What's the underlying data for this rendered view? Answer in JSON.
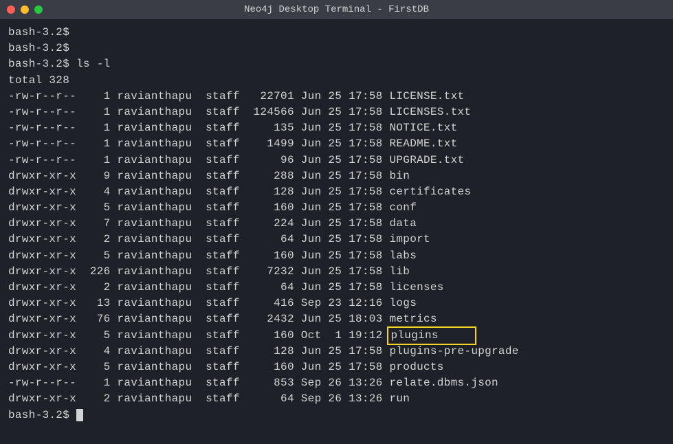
{
  "window": {
    "title": "Neo4j Desktop Terminal - FirstDB"
  },
  "prompt": "bash-3.2$",
  "command": "ls -l",
  "total_line": "total 328",
  "rows": [
    {
      "perm": "-rw-r--r--",
      "links": "1",
      "owner": "ravianthapu",
      "group": "staff",
      "size": "22701",
      "month": "Jun",
      "day": "25",
      "time": "17:58",
      "name": "LICENSE.txt",
      "hl": false
    },
    {
      "perm": "-rw-r--r--",
      "links": "1",
      "owner": "ravianthapu",
      "group": "staff",
      "size": "124566",
      "month": "Jun",
      "day": "25",
      "time": "17:58",
      "name": "LICENSES.txt",
      "hl": false
    },
    {
      "perm": "-rw-r--r--",
      "links": "1",
      "owner": "ravianthapu",
      "group": "staff",
      "size": "135",
      "month": "Jun",
      "day": "25",
      "time": "17:58",
      "name": "NOTICE.txt",
      "hl": false
    },
    {
      "perm": "-rw-r--r--",
      "links": "1",
      "owner": "ravianthapu",
      "group": "staff",
      "size": "1499",
      "month": "Jun",
      "day": "25",
      "time": "17:58",
      "name": "README.txt",
      "hl": false
    },
    {
      "perm": "-rw-r--r--",
      "links": "1",
      "owner": "ravianthapu",
      "group": "staff",
      "size": "96",
      "month": "Jun",
      "day": "25",
      "time": "17:58",
      "name": "UPGRADE.txt",
      "hl": false
    },
    {
      "perm": "drwxr-xr-x",
      "links": "9",
      "owner": "ravianthapu",
      "group": "staff",
      "size": "288",
      "month": "Jun",
      "day": "25",
      "time": "17:58",
      "name": "bin",
      "hl": false
    },
    {
      "perm": "drwxr-xr-x",
      "links": "4",
      "owner": "ravianthapu",
      "group": "staff",
      "size": "128",
      "month": "Jun",
      "day": "25",
      "time": "17:58",
      "name": "certificates",
      "hl": false
    },
    {
      "perm": "drwxr-xr-x",
      "links": "5",
      "owner": "ravianthapu",
      "group": "staff",
      "size": "160",
      "month": "Jun",
      "day": "25",
      "time": "17:58",
      "name": "conf",
      "hl": false
    },
    {
      "perm": "drwxr-xr-x",
      "links": "7",
      "owner": "ravianthapu",
      "group": "staff",
      "size": "224",
      "month": "Jun",
      "day": "25",
      "time": "17:58",
      "name": "data",
      "hl": false
    },
    {
      "perm": "drwxr-xr-x",
      "links": "2",
      "owner": "ravianthapu",
      "group": "staff",
      "size": "64",
      "month": "Jun",
      "day": "25",
      "time": "17:58",
      "name": "import",
      "hl": false
    },
    {
      "perm": "drwxr-xr-x",
      "links": "5",
      "owner": "ravianthapu",
      "group": "staff",
      "size": "160",
      "month": "Jun",
      "day": "25",
      "time": "17:58",
      "name": "labs",
      "hl": false
    },
    {
      "perm": "drwxr-xr-x",
      "links": "226",
      "owner": "ravianthapu",
      "group": "staff",
      "size": "7232",
      "month": "Jun",
      "day": "25",
      "time": "17:58",
      "name": "lib",
      "hl": false
    },
    {
      "perm": "drwxr-xr-x",
      "links": "2",
      "owner": "ravianthapu",
      "group": "staff",
      "size": "64",
      "month": "Jun",
      "day": "25",
      "time": "17:58",
      "name": "licenses",
      "hl": false
    },
    {
      "perm": "drwxr-xr-x",
      "links": "13",
      "owner": "ravianthapu",
      "group": "staff",
      "size": "416",
      "month": "Sep",
      "day": "23",
      "time": "12:16",
      "name": "logs",
      "hl": false
    },
    {
      "perm": "drwxr-xr-x",
      "links": "76",
      "owner": "ravianthapu",
      "group": "staff",
      "size": "2432",
      "month": "Jun",
      "day": "25",
      "time": "18:03",
      "name": "metrics",
      "hl": false
    },
    {
      "perm": "drwxr-xr-x",
      "links": "5",
      "owner": "ravianthapu",
      "group": "staff",
      "size": "160",
      "month": "Oct",
      "day": "1",
      "time": "19:12",
      "name": "plugins",
      "hl": true
    },
    {
      "perm": "drwxr-xr-x",
      "links": "4",
      "owner": "ravianthapu",
      "group": "staff",
      "size": "128",
      "month": "Jun",
      "day": "25",
      "time": "17:58",
      "name": "plugins-pre-upgrade",
      "hl": false
    },
    {
      "perm": "drwxr-xr-x",
      "links": "5",
      "owner": "ravianthapu",
      "group": "staff",
      "size": "160",
      "month": "Jun",
      "day": "25",
      "time": "17:58",
      "name": "products",
      "hl": false
    },
    {
      "perm": "-rw-r--r--",
      "links": "1",
      "owner": "ravianthapu",
      "group": "staff",
      "size": "853",
      "month": "Sep",
      "day": "26",
      "time": "13:26",
      "name": "relate.dbms.json",
      "hl": false
    },
    {
      "perm": "drwxr-xr-x",
      "links": "2",
      "owner": "ravianthapu",
      "group": "staff",
      "size": "64",
      "month": "Sep",
      "day": "26",
      "time": "13:26",
      "name": "run",
      "hl": false
    }
  ]
}
